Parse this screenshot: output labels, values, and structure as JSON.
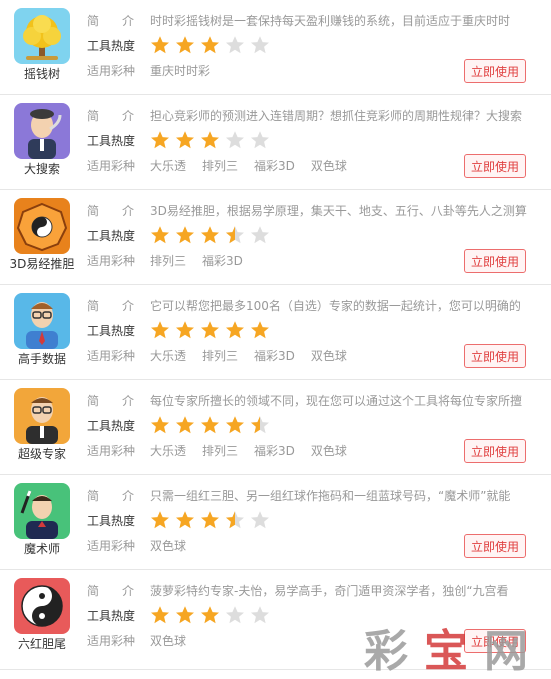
{
  "labels": {
    "intro_a": "简",
    "intro_b": "介",
    "heat": "工具热度",
    "apply": "适用彩种",
    "use_button": "立即使用"
  },
  "colors": {
    "accent": "#e04040",
    "star_full": "#f6a623",
    "star_empty": "#dddddd"
  },
  "tools": [
    {
      "name": "摇钱树",
      "icon": "money-tree-icon",
      "rating": 3,
      "desc": "时时彩摇钱树是一套保持每天盈利赚钱的系统，目前适应于重庆时时",
      "lotteries": [
        "重庆时时彩"
      ]
    },
    {
      "name": "大搜索",
      "icon": "detective-icon",
      "rating": 3,
      "desc": "担心竞彩师的预测进入连错周期？想抓住竞彩师的周期性规律？大搜索",
      "lotteries": [
        "大乐透",
        "排列三",
        "福彩3D",
        "双色球"
      ]
    },
    {
      "name": "3D易经推胆",
      "icon": "bagua-icon",
      "rating": 3.5,
      "desc": "3D易经推胆，根据易学原理，集天干、地支、五行、八卦等先人之测算",
      "lotteries": [
        "排列三",
        "福彩3D"
      ]
    },
    {
      "name": "高手数据",
      "icon": "expert-icon",
      "rating": 5,
      "desc": "它可以帮您把最多100名（自选）专家的数据一起统计，您可以明确的",
      "lotteries": [
        "大乐透",
        "排列三",
        "福彩3D",
        "双色球"
      ]
    },
    {
      "name": "超级专家",
      "icon": "super-expert-icon",
      "rating": 4.5,
      "desc": "每位专家所擅长的领域不同，现在您可以通过这个工具将每位专家所擅",
      "lotteries": [
        "大乐透",
        "排列三",
        "福彩3D",
        "双色球"
      ]
    },
    {
      "name": "魔术师",
      "icon": "magician-icon",
      "rating": 3.5,
      "desc": "只需一组红三胆、另一组红球作拖码和一组蓝球号码，“魔术师”就能",
      "lotteries": [
        "双色球"
      ]
    },
    {
      "name": "六红胆尾",
      "icon": "yin-yang-icon",
      "rating": 3,
      "desc": "菠萝彩特约专家-夫怡，易学高手，奇门遁甲资深学者，独创“九宫看",
      "lotteries": [
        "双色球"
      ]
    }
  ],
  "watermark": {
    "chars": [
      "彩",
      "宝",
      "网"
    ]
  }
}
